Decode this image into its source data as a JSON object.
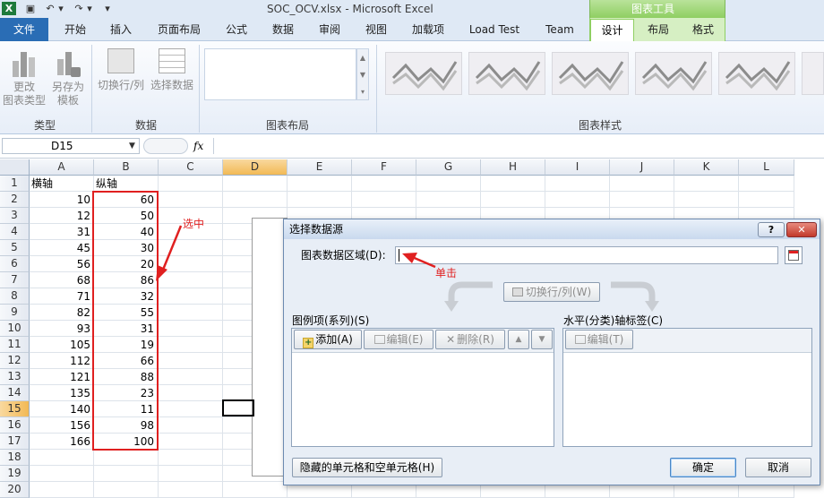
{
  "window": {
    "title": "SOC_OCV.xlsx  -  Microsoft Excel",
    "context_label": "图表工具",
    "quick_access": [
      "save-icon",
      "undo-icon",
      "redo-icon",
      "customize-icon"
    ]
  },
  "tabs": [
    "文件",
    "开始",
    "插入",
    "页面布局",
    "公式",
    "数据",
    "审阅",
    "视图",
    "加载项",
    "Load Test",
    "Team",
    "设计",
    "布局",
    "格式"
  ],
  "ribbon": {
    "groups": {
      "type": {
        "label": "类型",
        "buttons": [
          [
            "更改",
            "图表类型"
          ],
          [
            "另存为",
            "模板"
          ]
        ]
      },
      "data": {
        "label": "数据",
        "buttons": [
          "切换行/列",
          "选择数据"
        ]
      },
      "layout": {
        "label": "图表布局"
      },
      "styles": {
        "label": "图表样式"
      }
    }
  },
  "formula_bar": {
    "name_box": "D15",
    "fx": "fx",
    "content": ""
  },
  "sheet": {
    "columns": [
      "A",
      "B",
      "C",
      "D",
      "E",
      "F",
      "G",
      "H",
      "I",
      "J",
      "K",
      "L"
    ],
    "active_column": "D",
    "active_row": "15",
    "header_row": {
      "A": "横轴",
      "B": "纵轴"
    },
    "rows": [
      {
        "r": "1",
        "a": "横轴",
        "b": "纵轴"
      },
      {
        "r": "2",
        "a": "10",
        "b": "60"
      },
      {
        "r": "3",
        "a": "12",
        "b": "50"
      },
      {
        "r": "4",
        "a": "31",
        "b": "40"
      },
      {
        "r": "5",
        "a": "45",
        "b": "30"
      },
      {
        "r": "6",
        "a": "56",
        "b": "20"
      },
      {
        "r": "7",
        "a": "68",
        "b": "86"
      },
      {
        "r": "8",
        "a": "71",
        "b": "32"
      },
      {
        "r": "9",
        "a": "82",
        "b": "55"
      },
      {
        "r": "10",
        "a": "93",
        "b": "31"
      },
      {
        "r": "11",
        "a": "105",
        "b": "19"
      },
      {
        "r": "12",
        "a": "112",
        "b": "66"
      },
      {
        "r": "13",
        "a": "121",
        "b": "88"
      },
      {
        "r": "14",
        "a": "135",
        "b": "23"
      },
      {
        "r": "15",
        "a": "140",
        "b": "11"
      },
      {
        "r": "16",
        "a": "156",
        "b": "98"
      },
      {
        "r": "17",
        "a": "166",
        "b": "100"
      },
      {
        "r": "18",
        "a": "",
        "b": ""
      },
      {
        "r": "19",
        "a": "",
        "b": ""
      },
      {
        "r": "20",
        "a": "",
        "b": ""
      }
    ]
  },
  "annotations": {
    "selected": "选中",
    "click": "单击",
    "color": "#e02020"
  },
  "dialog": {
    "title": "选择数据源",
    "range_label": "图表数据区域(D):",
    "range_value": "",
    "switch_button": "切换行/列(W)",
    "legend_label": "图例项(系列)(S)",
    "legend_buttons": {
      "add": "添加(A)",
      "edit": "编辑(E)",
      "delete": "删除(R)"
    },
    "axis_label": "水平(分类)轴标签(C)",
    "axis_edit": "编辑(T)",
    "hidden_cells": "隐藏的单元格和空单元格(H)",
    "ok": "确定",
    "cancel": "取消"
  },
  "colors": {
    "accent": "#2a6db5",
    "context_green": "#8fcf62",
    "selection_red": "#e02020"
  }
}
